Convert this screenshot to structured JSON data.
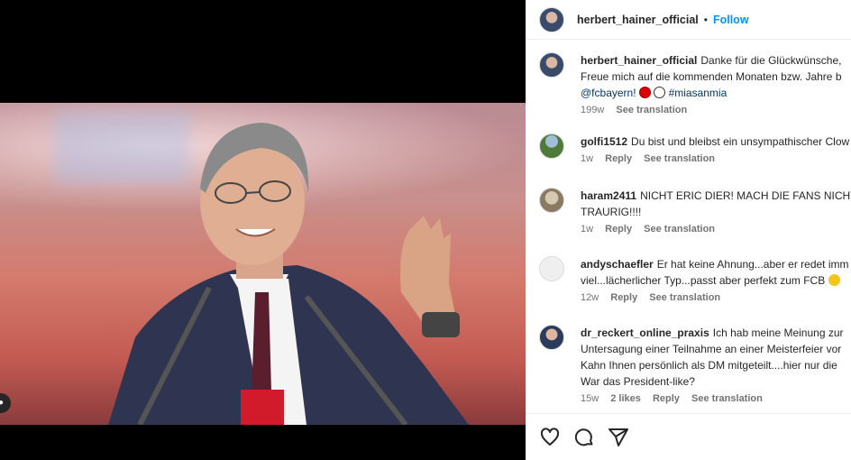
{
  "post": {
    "author": "herbert_hainer_official",
    "follow_label": "Follow",
    "separator": "•"
  },
  "caption": {
    "username": "herbert_hainer_official",
    "line1": "Danke für die Glückwünsche,",
    "line2": "Freue mich auf die kommenden Monaten bzw. Jahre b",
    "mention": "@fcbayern!",
    "hashtag": "#miasanmia",
    "time": "199w",
    "see_translation": "See translation"
  },
  "comments": [
    {
      "username": "golfi1512",
      "lines": [
        "Du bist und bleibst ein unsympathischer Clow"
      ],
      "time": "1w",
      "reply": "Reply",
      "see_translation": "See translation"
    },
    {
      "username": "haram2411",
      "lines": [
        "NICHT ERIC DIER! MACH DIE FANS NICHT",
        "TRAURIG!!!!"
      ],
      "time": "1w",
      "reply": "Reply",
      "see_translation": "See translation"
    },
    {
      "username": "andyschaefler",
      "lines": [
        "Er hat keine Ahnung...aber er redet imm",
        "viel...lächerlicher Typ...passt aber perfekt zum FCB"
      ],
      "time": "12w",
      "reply": "Reply",
      "see_translation": "See translation"
    },
    {
      "username": "dr_reckert_online_praxis",
      "lines": [
        "Ich hab meine Meinung zur",
        "Untersagung einer Teilnahme an einer Meisterfeier vor",
        "Kahn Ihnen persönlich als DM mitgeteilt....hier nur die",
        "War das President-like?"
      ],
      "time": "15w",
      "likes": "2 likes",
      "reply": "Reply",
      "see_translation": "See translation"
    }
  ],
  "icons": {
    "like": "heart-icon",
    "comment": "comment-icon",
    "share": "share-icon",
    "media_badge": "user-tag-icon"
  },
  "colors": {
    "accent": "#0095f6",
    "link": "#00376b",
    "muted": "#737373"
  }
}
